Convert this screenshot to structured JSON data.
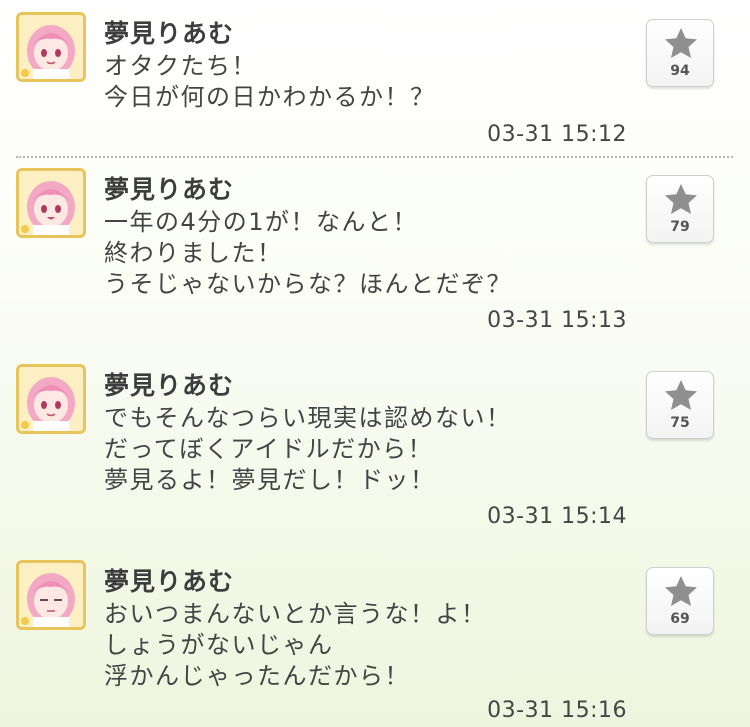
{
  "posts": [
    {
      "author": "夢見りあむ",
      "lines": [
        "オタクたち！",
        "今日が何の日かわかるか！？"
      ],
      "timestamp": "03-31 15:12",
      "star_count": "94"
    },
    {
      "author": "夢見りあむ",
      "lines": [
        "一年の4分の1が！なんと！",
        "終わりました！",
        "うそじゃないからな？ほんとだぞ？"
      ],
      "timestamp": "03-31 15:13",
      "star_count": "79"
    },
    {
      "author": "夢見りあむ",
      "lines": [
        "でもそんなつらい現実は認めない！",
        "だってぼくアイドルだから！",
        "夢見るよ！夢見だし！ドッ！"
      ],
      "timestamp": "03-31 15:14",
      "star_count": "75"
    },
    {
      "author": "夢見りあむ",
      "lines": [
        "おいつまんないとか言うな！よ！",
        "しょうがないじゃん",
        "浮かんじゃったんだから！"
      ],
      "timestamp": "03-31 15:16",
      "star_count": "69"
    }
  ],
  "icons": {
    "avatar": "avatar-icon",
    "star": "star-icon"
  },
  "colors": {
    "avatar_border": "#e8c55a",
    "hair": "#f3a9c4",
    "star": "#8f8f8f"
  }
}
